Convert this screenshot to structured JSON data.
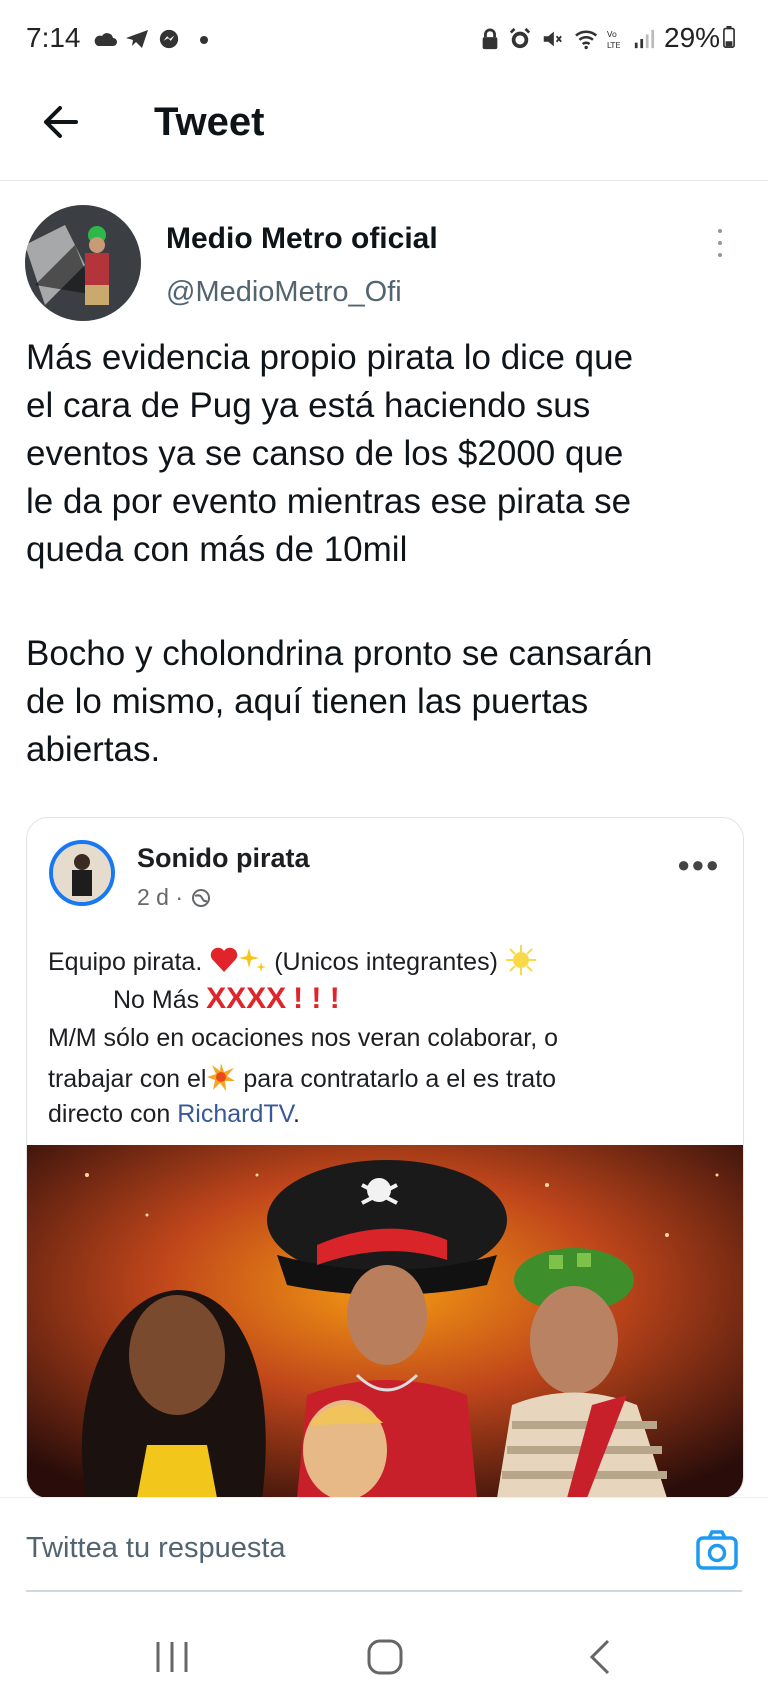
{
  "status_bar": {
    "time": "7:14",
    "battery": "29%",
    "icons": [
      "cloud-icon",
      "telegram-icon",
      "messenger-icon",
      "dot-icon",
      "lock-icon",
      "alarm-icon",
      "mute-icon",
      "wifi-icon",
      "volte-icon",
      "signal-icon",
      "battery-icon"
    ]
  },
  "header": {
    "title": "Tweet",
    "back_icon": "arrow-left-icon"
  },
  "tweet": {
    "author_name": "Medio Metro oficial",
    "author_handle": "@MedioMetro_Ofi",
    "text_lines": [
      "Más evidencia propio pirata lo dice que",
      "el cara de Pug ya está haciendo sus",
      "eventos ya se canso de los $2000 que",
      "le da por evento mientras ese pirata se",
      "queda con más de 10mil",
      "Bocho y cholondrina pronto se cansarán",
      "de lo mismo, aquí tienen las puertas",
      "abiertas."
    ]
  },
  "embedded_post": {
    "page_name": "Sonido pirata",
    "time": "2 d ·",
    "line1_text": "Equipo pirata.",
    "line1_paren": "(Unicos integrantes)",
    "line2_text": "No Más",
    "line2_marks": "XXXX",
    "line2_excl": "! ! !",
    "line3": "M/M sólo en ocaciones nos veran colaborar, o",
    "line4_a": "trabajar con el",
    "line4_b": "para contratarlo a el es trato",
    "line5_a": "directo con ",
    "line5_link": "RichardTV",
    "line5_b": "."
  },
  "reply": {
    "placeholder": "Twittea tu respuesta",
    "camera_icon": "camera-icon"
  },
  "colors": {
    "accent": "#1d9bf0",
    "text_primary": "#0f1419",
    "text_secondary": "#536471",
    "fb_blue": "#1877f2"
  }
}
